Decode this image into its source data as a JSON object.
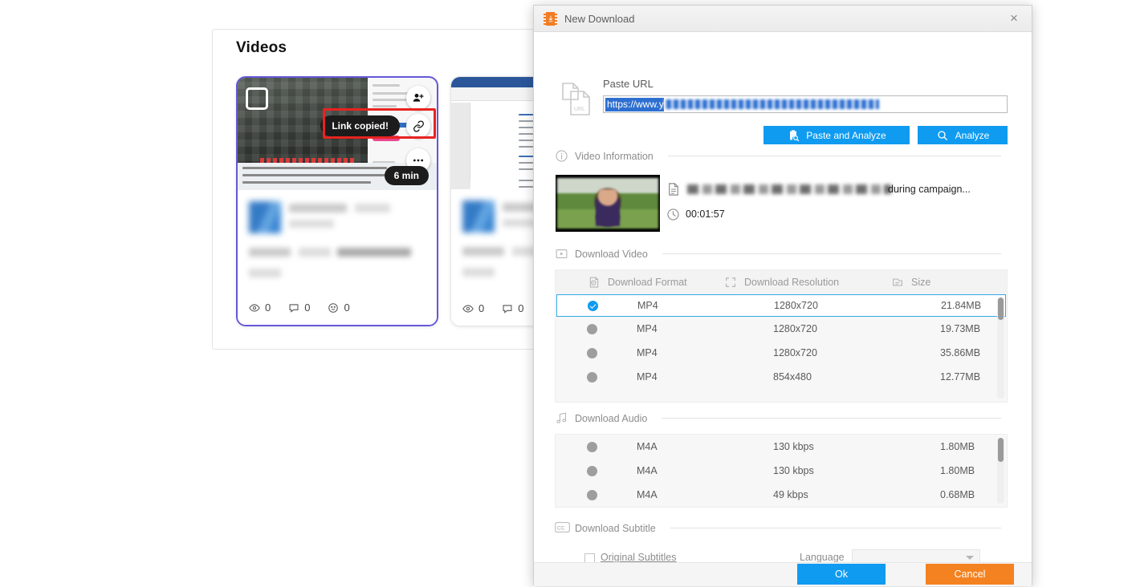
{
  "background_page": {
    "title": "Videos",
    "cards": [
      {
        "badge": "6 min",
        "toast": "Link copied!",
        "stats": [
          {
            "icon": "eye-icon",
            "value": "0"
          },
          {
            "icon": "comment-icon",
            "value": "0"
          },
          {
            "icon": "reaction-icon",
            "value": "0"
          }
        ]
      },
      {
        "stats": [
          {
            "icon": "eye-icon",
            "value": "0"
          },
          {
            "icon": "comment-icon",
            "value": "0"
          }
        ]
      }
    ]
  },
  "dialog": {
    "title": "New Download",
    "title_icon": "video-download-icon",
    "close_label": "×",
    "url": {
      "icon": "url-file-icon",
      "label": "Paste URL",
      "value": "https://www.y",
      "value_is_selected": true
    },
    "actions": {
      "paste_and_analyze": "Paste and Analyze",
      "paste_icon": "clipboard-search-icon",
      "analyze": "Analyze",
      "analyze_icon": "search-icon"
    },
    "video_information": {
      "section_label": "Video Information",
      "section_icon": "info-icon",
      "title_icon": "document-icon",
      "title_tail": "during campaign...",
      "duration_icon": "clock-icon",
      "duration": "00:01:57"
    },
    "download_video": {
      "section_label": "Download Video",
      "section_icon": "video-icon",
      "columns": [
        {
          "label": "Download Format",
          "icon": "media-format-icon"
        },
        {
          "label": "Download Resolution",
          "icon": "resolution-icon"
        },
        {
          "label": "Size",
          "icon": "file-size-icon"
        }
      ],
      "rows": [
        {
          "selected": true,
          "format": "MP4",
          "resolution": "1280x720",
          "size": "21.84MB"
        },
        {
          "selected": false,
          "format": "MP4",
          "resolution": "1280x720",
          "size": "19.73MB"
        },
        {
          "selected": false,
          "format": "MP4",
          "resolution": "1280x720",
          "size": "35.86MB"
        },
        {
          "selected": false,
          "format": "MP4",
          "resolution": "854x480",
          "size": "12.77MB"
        }
      ]
    },
    "download_audio": {
      "section_label": "Download Audio",
      "section_icon": "music-note-icon",
      "rows": [
        {
          "selected": false,
          "format": "M4A",
          "bitrate": "130 kbps",
          "size": "1.80MB"
        },
        {
          "selected": false,
          "format": "M4A",
          "bitrate": "130 kbps",
          "size": "1.80MB"
        },
        {
          "selected": false,
          "format": "M4A",
          "bitrate": "49 kbps",
          "size": "0.68MB"
        }
      ]
    },
    "download_subtitle": {
      "section_label": "Download Subtitle",
      "section_icon": "cc-icon",
      "original_subtitles_label": "Original Subtitles",
      "original_subtitles_checked": false,
      "language_label": "Language",
      "language_value": ""
    },
    "footer": {
      "ok": "Ok",
      "cancel": "Cancel"
    }
  },
  "colors": {
    "accent_blue": "#0f9bf0",
    "accent_orange": "#f58220",
    "selection_blue": "#2d6fd0",
    "card_border_purple": "#6558d8",
    "annotation_red": "#e8231f"
  }
}
